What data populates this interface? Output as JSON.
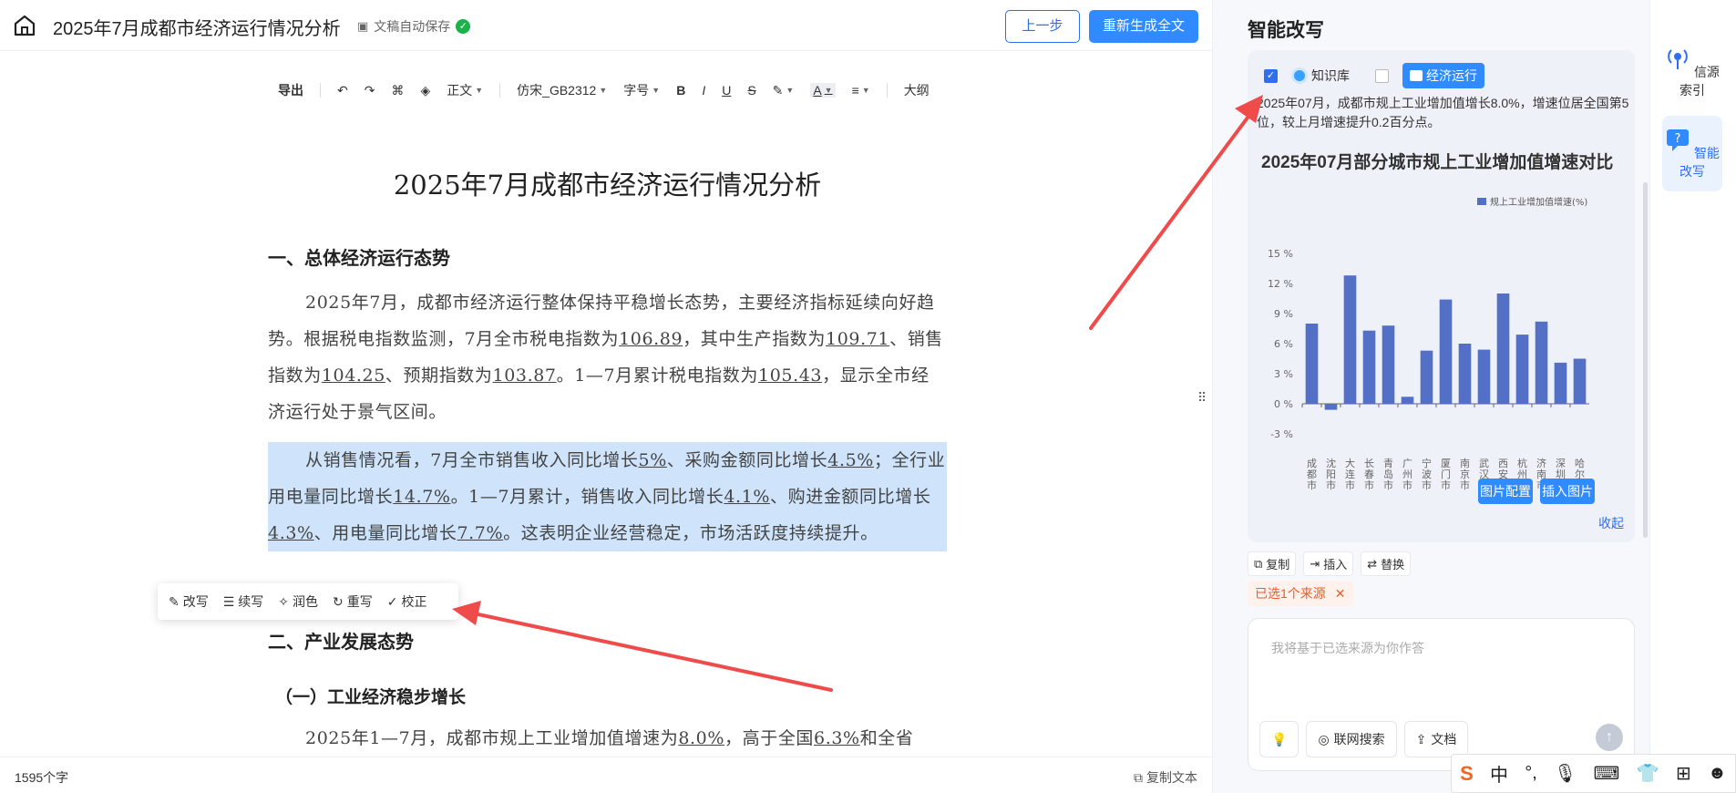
{
  "header": {
    "title": "2025年7月成都市经济运行情况分析",
    "autosave": "文稿自动保存",
    "prev_button": "上一步",
    "regen_button": "重新生成全文"
  },
  "toolbar": {
    "export": "导出",
    "style": "正文",
    "font": "仿宋_GB2312",
    "size": "字号",
    "outline": "大纲"
  },
  "document": {
    "h1": "2025年7月成都市经济运行情况分析",
    "sec1": "一、总体经济运行态势",
    "sec2": "二、产业发展态势",
    "sec2_1": "（一）工业经济稳步增长",
    "p1": [
      "2025年7月，成都市经济运行整体保持平稳增长态势，主要经济指标延续向好趋势。根据税电指数监测，7月全市税电指数为",
      "106.89",
      "，其中生产指数为",
      "109.71",
      "、销售指数为",
      "104.25",
      "、预期指数为",
      "103.87",
      "。1—7月累计税电指数为",
      "105.43",
      "，显示全市经济运行处于景气区间。"
    ],
    "p2": [
      "从销售情况看，7月全市销售收入同比增长",
      "5%",
      "、采购金额同比增长",
      "4.5%",
      "；全行业用电量同比增长",
      "14.7%",
      "。1—7月累计，销售收入同比增长",
      "4.1%",
      "、购进金额同比增长",
      "4.3%",
      "、用电量同比增长",
      "7.7%",
      "。这表明企业经营稳定，市场活跃度持续提升。"
    ],
    "p3": [
      "2025年1—7月，成都市规上工业增加值增速为",
      "8.0%",
      "，高于全国",
      "6.3%",
      "和全省"
    ]
  },
  "float_menu": [
    "改写",
    "续写",
    "润色",
    "重写",
    "校正"
  ],
  "status": {
    "word_count": "1595个字",
    "copy_text": "复制文本"
  },
  "panel": {
    "title": "智能改写",
    "kb_label": "知识库",
    "econ_label": "经济运行",
    "summary": "2025年07月，成都市规上工业增加值增长8.0%，增速位居全国第5位，较上月增速提升0.2百分点。",
    "img_config": "图片配置",
    "insert_img": "插入图片",
    "collapse": "收起",
    "actions": [
      "复制",
      "插入",
      "替换"
    ],
    "selected_source": "已选1个来源",
    "input_placeholder": "我将基于已选来源为你作答",
    "web_search": "联网搜索",
    "doc": "文档"
  },
  "rail": {
    "source_index": "信源索引",
    "smart_rewrite": "智能改写"
  },
  "chart_data": {
    "type": "bar",
    "title": "2025年07月部分城市规上工业增加值增速对比",
    "legend": [
      "规上工业增加值增速(%)"
    ],
    "categories": [
      "成都市",
      "沈阳市",
      "大连市",
      "长春市",
      "青岛市",
      "广州市",
      "宁波市",
      "厦门市",
      "南京市",
      "武汉市",
      "西安市",
      "杭州市",
      "济南市",
      "深圳市",
      "哈尔滨市"
    ],
    "values": [
      8.0,
      -0.6,
      12.8,
      7.3,
      7.8,
      0.7,
      5.3,
      10.4,
      6.0,
      5.4,
      11.0,
      6.9,
      8.2,
      4.1,
      4.5
    ],
    "ylim": [
      -3,
      15
    ],
    "yticks": [
      "15 %",
      "12 %",
      "9 %",
      "6 %",
      "3 %",
      "0 %",
      "-3 %"
    ],
    "color": "#5470c6"
  },
  "ime": {
    "lang": "中",
    "punct": "°,"
  }
}
